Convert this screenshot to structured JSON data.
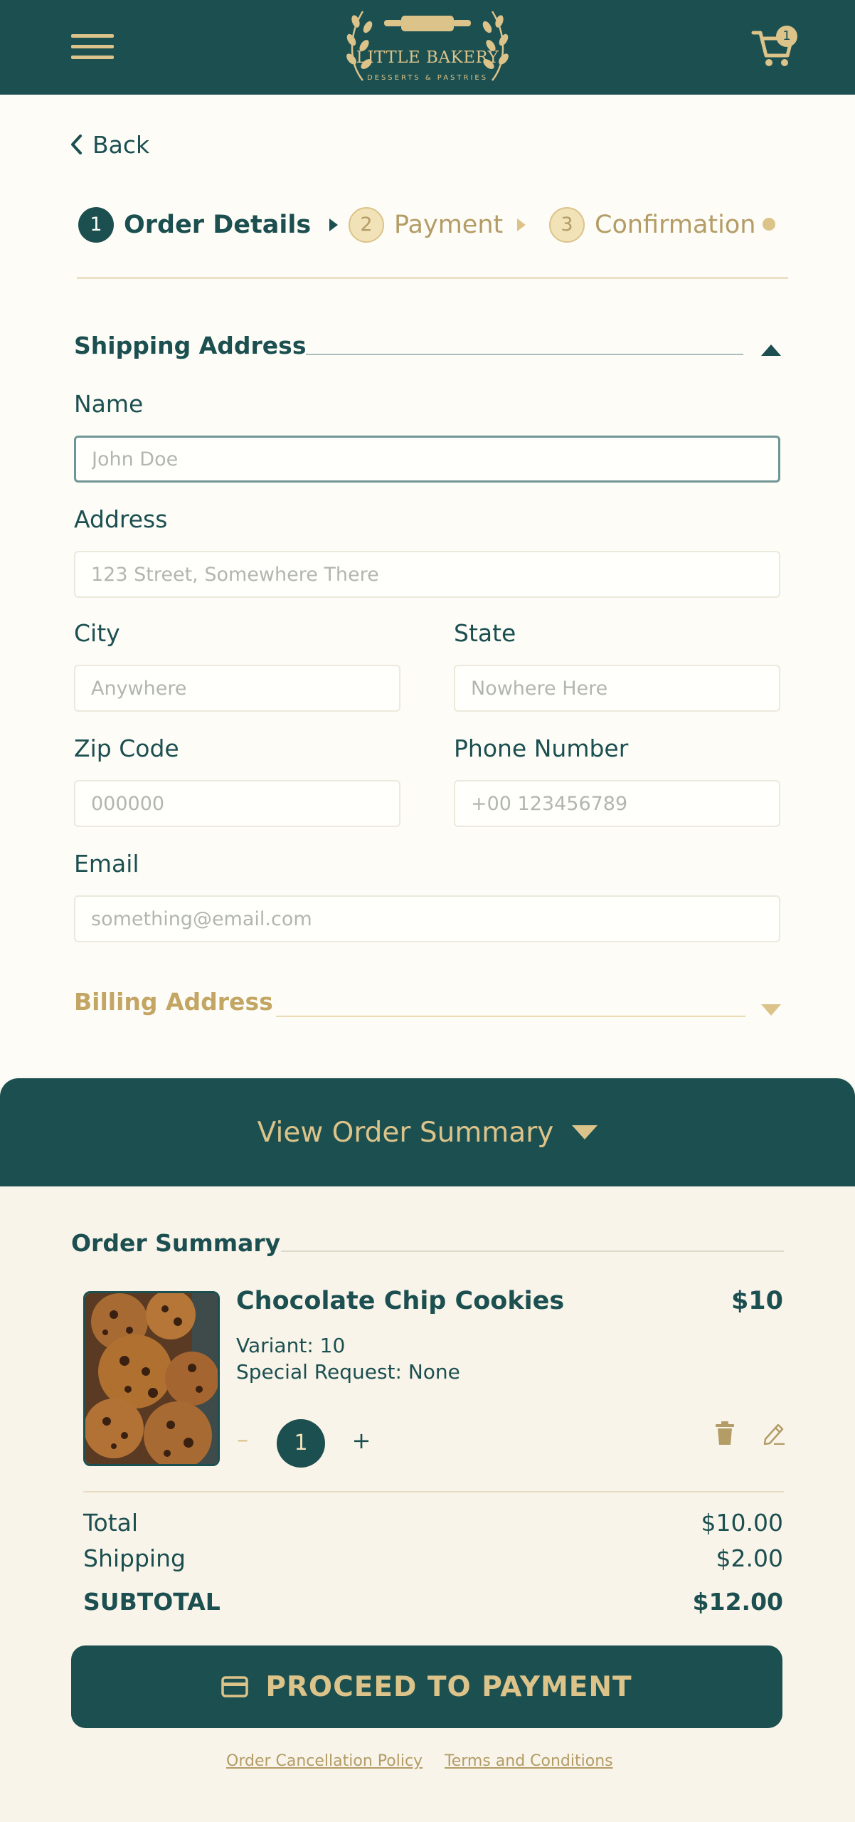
{
  "colors": {
    "primary": "#1c4f50",
    "accent": "#dcc38a",
    "background": "#fdfcf6",
    "summary_background": "#f8f4ea"
  },
  "header": {
    "menu_icon": "hamburger-menu-icon",
    "logo_title": "LITTLE BAKERY",
    "logo_subtitle": "DESSERTS & PASTRIES",
    "cart_icon": "shopping-cart-icon",
    "cart_count": "1"
  },
  "back": {
    "label": "Back"
  },
  "steps": [
    {
      "number": "1",
      "label": "Order Details",
      "state": "active"
    },
    {
      "number": "2",
      "label": "Payment",
      "state": "inactive"
    },
    {
      "number": "3",
      "label": "Confirmation",
      "state": "inactive"
    }
  ],
  "shipping": {
    "title": "Shipping Address",
    "expanded": true,
    "fields": {
      "name": {
        "label": "Name",
        "value": "",
        "placeholder": "John Doe"
      },
      "address": {
        "label": "Address",
        "value": "",
        "placeholder": "123 Street, Somewhere There"
      },
      "city": {
        "label": "City",
        "value": "",
        "placeholder": "Anywhere"
      },
      "state": {
        "label": "State",
        "value": "",
        "placeholder": "Nowhere Here"
      },
      "zip": {
        "label": "Zip Code",
        "value": "",
        "placeholder": "000000"
      },
      "phone": {
        "label": "Phone Number",
        "value": "",
        "placeholder": "+00 123456789"
      },
      "email": {
        "label": "Email",
        "value": "",
        "placeholder": "something@email.com"
      }
    }
  },
  "billing": {
    "title": "Billing Address",
    "expanded": false
  },
  "summary_toggle": {
    "label": "View Order Summary"
  },
  "order_summary": {
    "title": "Order Summary",
    "items": [
      {
        "name": "Chocolate Chip Cookies",
        "price": "$10",
        "variant": "Variant: 10",
        "special_request": "Special Request: None",
        "quantity": "1",
        "minus": "–",
        "plus": "+"
      }
    ],
    "totals": {
      "total_label": "Total",
      "total_value": "$10.00",
      "shipping_label": "Shipping",
      "shipping_value": "$2.00",
      "subtotal_label": "SUBTOTAL",
      "subtotal_value": "$12.00"
    }
  },
  "proceed": {
    "label": "PROCEED TO PAYMENT",
    "icon": "credit-card-icon"
  },
  "footer": {
    "cancellation_link": "Order Cancellation Policy",
    "terms_link": "Terms and Conditions"
  }
}
